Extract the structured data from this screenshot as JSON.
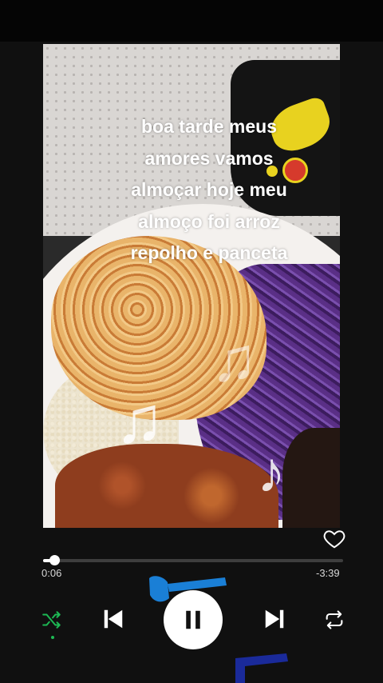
{
  "video": {
    "caption_lines": [
      "boa tarde meus",
      "amores vamos",
      "almoçar hoje meu",
      "almoço foi arroz",
      "repolho e panceta"
    ]
  },
  "player": {
    "elapsed": "0:06",
    "remaining": "-3:39",
    "progress_fraction": 0.036,
    "liked": false,
    "shuffle_active": true,
    "state": "playing"
  },
  "icons": {
    "like": "heart-outline-icon",
    "shuffle": "shuffle-icon",
    "previous": "skip-previous-icon",
    "play_pause": "pause-icon",
    "next": "skip-next-icon",
    "repeat": "repeat-icon",
    "decor": "music-note-icon"
  },
  "colors": {
    "background": "#101010",
    "accent": "#1db954",
    "note_blue": "#1a7fd6",
    "note_navy": "#1a2a9a"
  }
}
